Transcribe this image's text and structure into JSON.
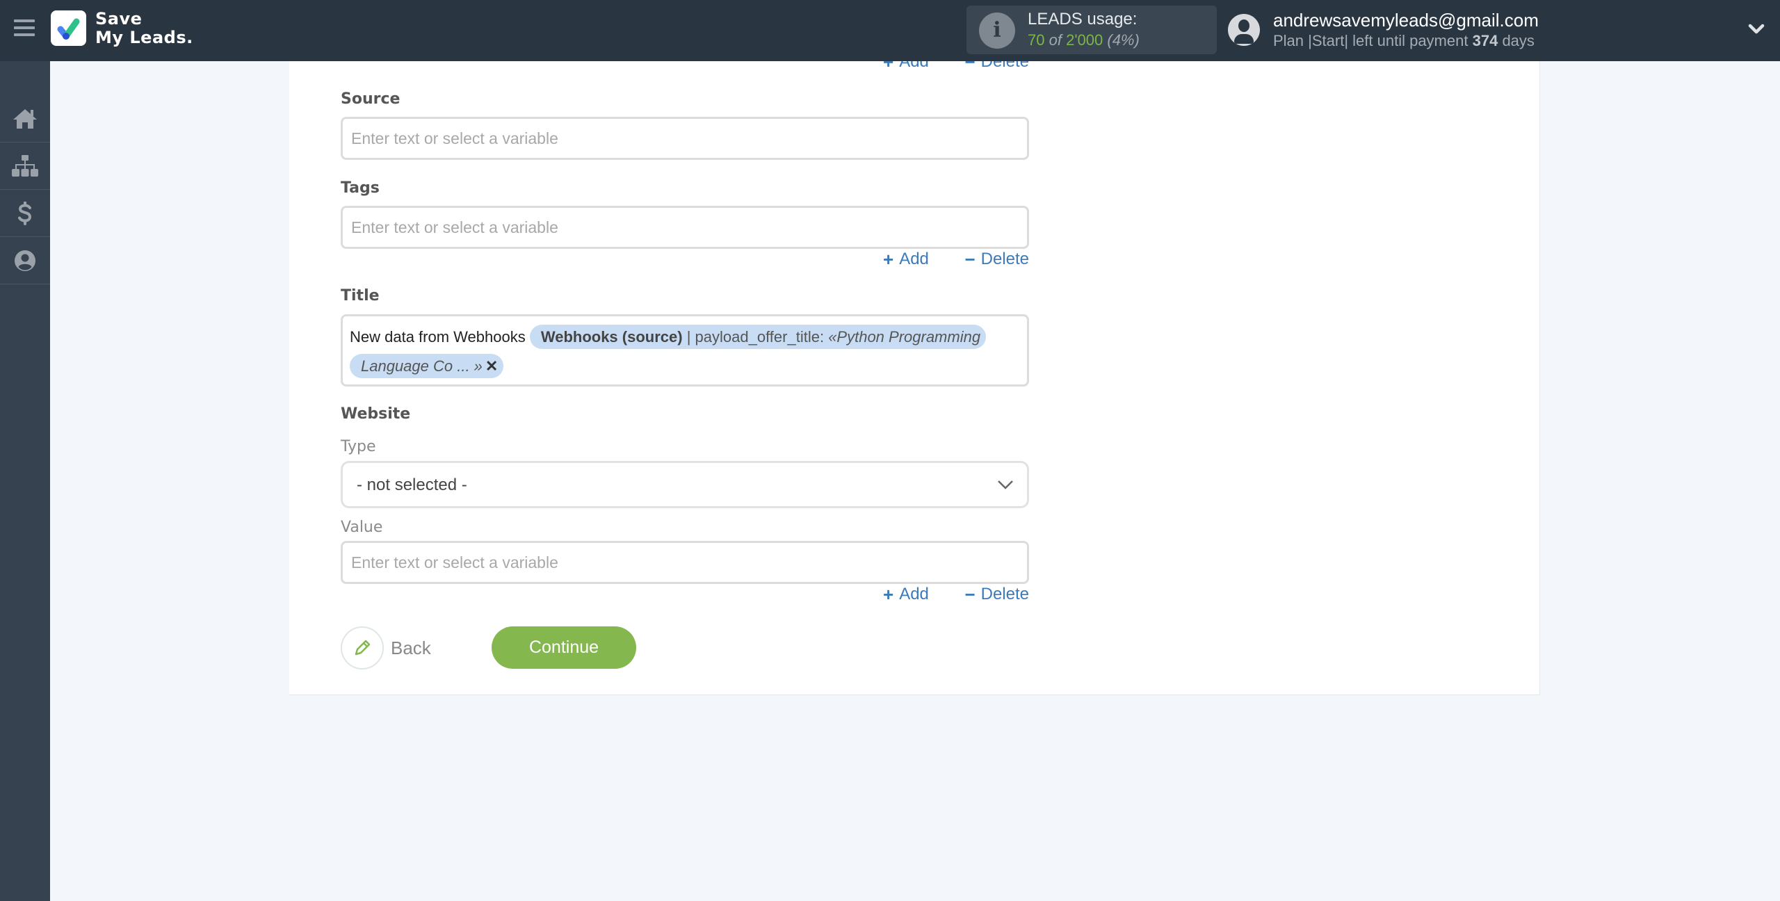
{
  "header": {
    "brand_line1": "Save",
    "brand_line2": "My Leads.",
    "usage": {
      "title": "LEADS usage:",
      "used": "70",
      "of_label": "of",
      "limit": "2'000",
      "percent": "(4%)"
    },
    "user": {
      "email": "andrewsavemyleads@gmail.com",
      "plan_prefix": "Plan |Start| left until payment",
      "days": "374",
      "days_suffix": "days"
    }
  },
  "sidebar": {
    "items": [
      {
        "name": "home",
        "icon": "home-icon"
      },
      {
        "name": "connections",
        "icon": "sitemap-icon"
      },
      {
        "name": "billing",
        "icon": "dollar-icon"
      },
      {
        "name": "account",
        "icon": "user-circle-icon"
      }
    ]
  },
  "form": {
    "add_label": "Add",
    "delete_label": "Delete",
    "source": {
      "label": "Source",
      "placeholder": "Enter text or select a variable",
      "value": ""
    },
    "tags": {
      "label": "Tags",
      "placeholder": "Enter text or select a variable",
      "value": ""
    },
    "title": {
      "label": "Title",
      "static_text": "New data from Webhooks",
      "chip_source": "Webhooks (source)",
      "chip_sep": " | ",
      "chip_field": "payload_offer_title:",
      "chip_value": "«Python Programming Language Co ... »",
      "chip_remove": "✕"
    },
    "website": {
      "label": "Website",
      "type_label": "Type",
      "type_selected": "- not selected -",
      "value_label": "Value",
      "value_placeholder": "Enter text or select a variable",
      "value": ""
    },
    "back_label": "Back",
    "continue_label": "Continue"
  },
  "colors": {
    "header_bg": "#2a3542",
    "sidebar_bg": "#36424f",
    "accent_green": "#84b74e",
    "link_blue": "#3d7ab8",
    "chip_bg": "#c8ddf4"
  }
}
